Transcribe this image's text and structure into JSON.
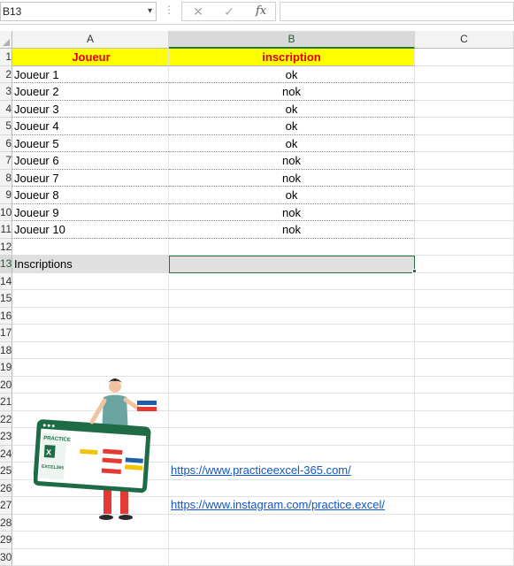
{
  "formula_bar": {
    "name_box": "B13",
    "cancel_icon": "x-icon",
    "enter_icon": "check-icon",
    "function_label": "fx",
    "formula_value": ""
  },
  "columns": [
    "A",
    "B",
    "C"
  ],
  "rows": [
    "1",
    "2",
    "3",
    "4",
    "5",
    "6",
    "7",
    "8",
    "9",
    "10",
    "11",
    "12",
    "13",
    "14",
    "15",
    "16",
    "17",
    "18",
    "19",
    "20",
    "21",
    "22",
    "23",
    "24",
    "25",
    "26",
    "27",
    "28",
    "29",
    "30"
  ],
  "table": {
    "header_joueur": "Joueur",
    "header_inscription": "inscription",
    "players": [
      {
        "name": "Joueur 1",
        "status": "ok"
      },
      {
        "name": "Joueur 2",
        "status": "nok"
      },
      {
        "name": "Joueur 3",
        "status": "ok"
      },
      {
        "name": "Joueur 4",
        "status": "ok"
      },
      {
        "name": "Joueur 5",
        "status": "ok"
      },
      {
        "name": "Joueur 6",
        "status": "nok"
      },
      {
        "name": "Joueur 7",
        "status": "nok"
      },
      {
        "name": "Joueur 8",
        "status": "ok"
      },
      {
        "name": "Joueur 9",
        "status": "nok"
      },
      {
        "name": "Joueur 10",
        "status": "nok"
      }
    ],
    "summary_label": "Inscriptions",
    "summary_value": ""
  },
  "links": {
    "website": "https://www.practiceexcel-365.com/",
    "instagram": "https://www.instagram.com/practice.excel/"
  },
  "logo": {
    "text_line1": "PRACTICE",
    "text_line2": "EXCEL365"
  },
  "colors": {
    "header_fill": "#ffff00",
    "header_text": "#e00000",
    "selection": "#217346",
    "link": "#1155cc"
  }
}
